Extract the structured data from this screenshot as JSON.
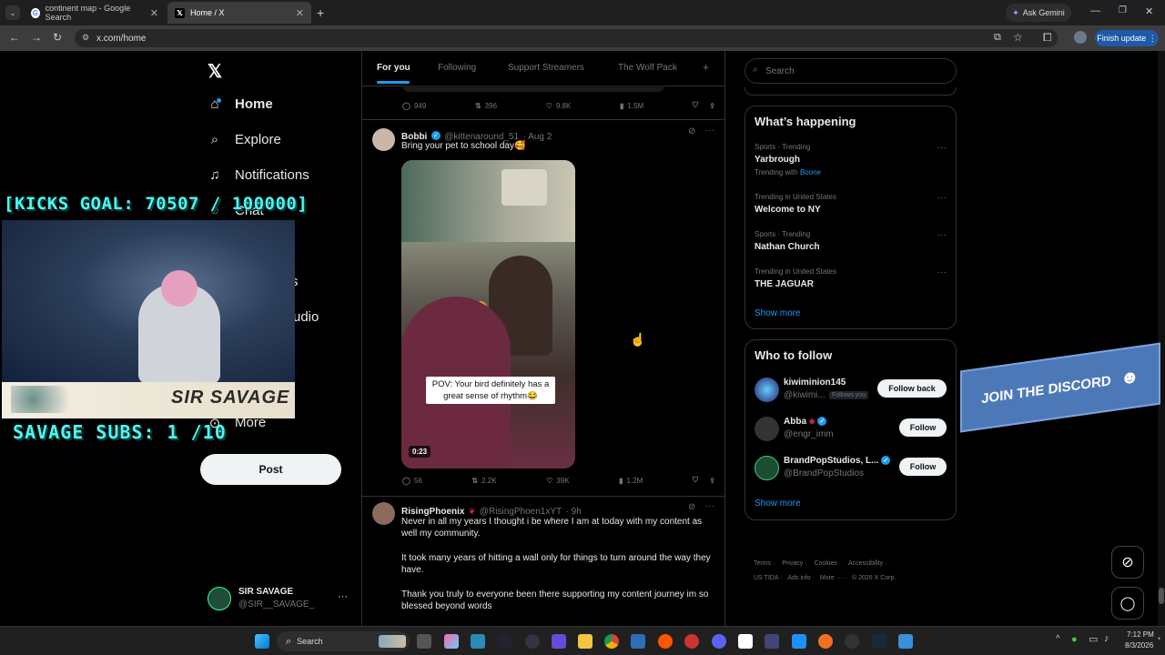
{
  "browser": {
    "tabs": [
      {
        "title": "continent map - Google Search",
        "icon": "google-icon"
      },
      {
        "title": "Home / X",
        "icon": "x-icon"
      }
    ],
    "ask_gemini": "Ask Gemini",
    "url": "x.com/home",
    "finish_update": "Finish update"
  },
  "sidebar": {
    "items": [
      {
        "label": "Home",
        "icon": "home-icon"
      },
      {
        "label": "Explore",
        "icon": "search-icon"
      },
      {
        "label": "Notifications",
        "icon": "bell-icon"
      },
      {
        "label": "Chat",
        "icon": "chat-icon"
      },
      {
        "label": "s",
        "icon": ""
      },
      {
        "label": "udio",
        "icon": ""
      },
      {
        "label": "More",
        "icon": "more-icon"
      }
    ],
    "post_label": "Post",
    "account": {
      "name": "SIR SAVAGE",
      "handle": "@SIR__SAVAGE_"
    }
  },
  "overlay": {
    "kicks_goal": "[KICKS GOAL: 70507 / 100000]",
    "savage_subs": "SAVAGE SUBS: 1 /10",
    "webcam_banner": "SIR SAVAGE",
    "discord": "JOIN THE DISCORD"
  },
  "feed": {
    "tabs": [
      "For you",
      "Following",
      "Support Streamers",
      "The Wolf Pack"
    ],
    "add_tab": "+",
    "prev_actions": {
      "replies": "949",
      "reposts": "396",
      "likes": "9.8K",
      "views": "1.5M"
    },
    "tweets": [
      {
        "name": "Bobbi",
        "handle": "@kittenaround_51",
        "time": "· Aug 2",
        "text": "Bring your pet to school day🥰",
        "video_caption": "POV: Your bird definitely has a great sense of rhythm😂",
        "duration": "0:23",
        "actions": {
          "replies": "56",
          "reposts": "2.2K",
          "likes": "39K",
          "views": "1.2M"
        }
      },
      {
        "name": "RisingPhoenix",
        "handle": "@RisingPhoen1xYT",
        "time": "· 9h",
        "paragraphs": [
          "Never in all my years I thought i be where I am at today with my content as well my community.",
          "It took many years of hitting a wall only for things to turn around the way they have.",
          "Thank you truly to everyone been there supporting my content journey im so blessed beyond words"
        ]
      }
    ]
  },
  "right": {
    "search_placeholder": "Search",
    "happening_title": "What’s happening",
    "trends": [
      {
        "meta": "Sports · Trending",
        "title": "Yarbrough",
        "sub": "Trending with",
        "sub_link": "Boone"
      },
      {
        "meta": "Trending in United States",
        "title": "Welcome to NY"
      },
      {
        "meta": "Sports · Trending",
        "title": "Nathan Church"
      },
      {
        "meta": "Trending in United States",
        "title": "THE JAGUAR"
      }
    ],
    "show_more": "Show more",
    "who_title": "Who to follow",
    "follows": [
      {
        "name": "kiwiminion145",
        "handle": "@kiwimi...",
        "badge": "Follows you",
        "button": "Follow back"
      },
      {
        "name": "Abba",
        "handle": "@engr_imm",
        "button": "Follow"
      },
      {
        "name": "BrandPopStudios, L...",
        "handle": "@BrandPopStudios",
        "button": "Follow"
      }
    ],
    "footer": [
      "Terms",
      "Privacy",
      "Cookies",
      "Accessibility",
      "US TIDA",
      "Ads info",
      "More ···",
      "© 2026 X Corp."
    ]
  },
  "taskbar": {
    "search": "Search",
    "time": "7:12 PM",
    "date": "8/3/2026"
  }
}
